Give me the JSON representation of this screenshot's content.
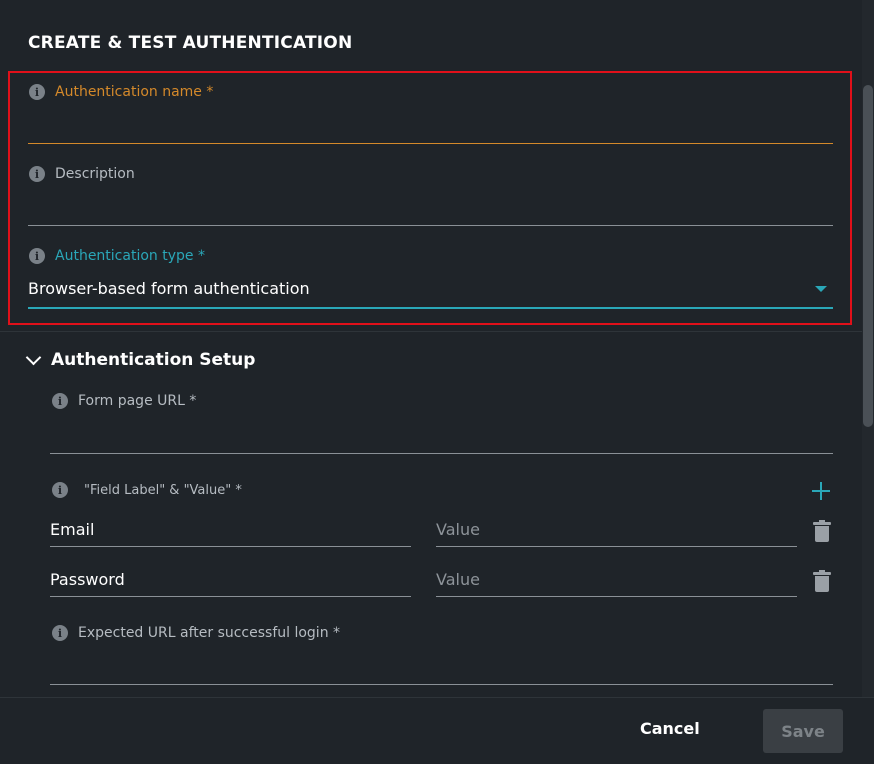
{
  "dialog": {
    "title": "CREATE & TEST AUTHENTICATION"
  },
  "fields": {
    "auth_name": {
      "label": "Authentication name *",
      "value": ""
    },
    "description": {
      "label": "Description",
      "value": ""
    },
    "auth_type": {
      "label": "Authentication type *",
      "value": "Browser-based form authentication"
    }
  },
  "setup": {
    "section_title": "Authentication Setup",
    "form_page_url": {
      "label": "Form page URL *",
      "value": ""
    },
    "field_pairs_label": "\"Field Label\" & \"Value\" *",
    "pairs": [
      {
        "label": "Email",
        "value_placeholder": "Value"
      },
      {
        "label": "Password",
        "value_placeholder": "Value"
      }
    ],
    "expected_url": {
      "label": "Expected URL after successful login *",
      "value": ""
    }
  },
  "footer": {
    "cancel_label": "Cancel",
    "save_label": "Save"
  },
  "icons": {
    "info": "info-icon",
    "chevron": "chevron-down-icon",
    "add": "plus-icon",
    "delete": "trash-icon",
    "dropdown": "caret-down-icon"
  },
  "colors": {
    "background": "#1f2429",
    "accent_teal": "#2aa7b8",
    "required_orange": "#d4892a",
    "highlight_red": "#e0101a"
  },
  "info_glyph": "i"
}
